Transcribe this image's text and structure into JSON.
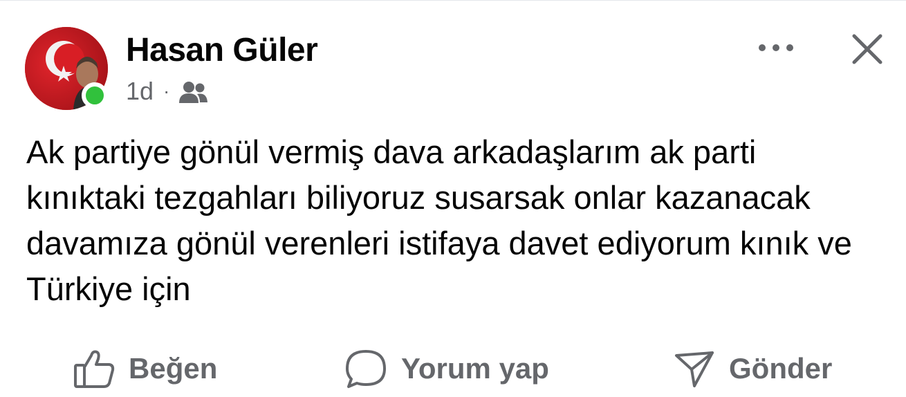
{
  "post": {
    "author": "Hasan Güler",
    "time": "1d",
    "separator": "·",
    "audience_icon": "friends-icon",
    "text": "Ak partiye gönül vermiş dava arkadaşlarım ak parti kınıktaki tezgahları biliyoruz susarsak onlar kazanacak davamıza gönül verenleri istifaya davet ediyorum kınık ve Türkiye için",
    "online": true
  },
  "actions": {
    "like_label": "Beğen",
    "comment_label": "Yorum yap",
    "send_label": "Gönder"
  },
  "icons": {
    "more": "more-horizontal-icon",
    "close": "close-icon",
    "like": "thumbs-up-icon",
    "comment": "comment-bubble-icon",
    "send": "send-icon"
  },
  "colors": {
    "text": "#050505",
    "secondary": "#65676b",
    "online": "#31c13c",
    "flag_red": "#e30a17"
  }
}
